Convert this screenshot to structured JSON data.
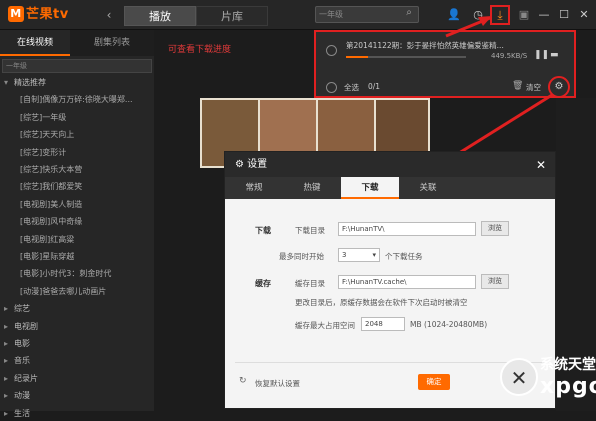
{
  "app": {
    "logo_text": "芒果tv",
    "logo_mark": "M"
  },
  "topbar": {
    "back_icon": "back-arrow-icon",
    "tabs": [
      "播放",
      "片库"
    ],
    "search_placeholder": "一年级",
    "search_icon": "search-icon",
    "icons": [
      "user-icon",
      "history-icon",
      "download-icon",
      "skin-icon",
      "minimize-icon",
      "maximize-icon",
      "close-icon"
    ],
    "download_tooltip": "下载"
  },
  "sidebar": {
    "tabs": [
      "在线视频",
      "剧集列表"
    ],
    "search_value": "一年级",
    "items": [
      {
        "label": "精选推荐",
        "sub": false,
        "arrow": "▾"
      },
      {
        "label": "[自制]偶像万万碎:徐晓大曝郑...",
        "sub": true
      },
      {
        "label": "[综艺]一年级",
        "sub": true
      },
      {
        "label": "[综艺]天天向上",
        "sub": true
      },
      {
        "label": "[综艺]变形计",
        "sub": true
      },
      {
        "label": "[综艺]快乐大本营",
        "sub": true
      },
      {
        "label": "[综艺]我们都爱笑",
        "sub": true
      },
      {
        "label": "[电视剧]美人制造",
        "sub": true
      },
      {
        "label": "[电视剧]风中奇缘",
        "sub": true
      },
      {
        "label": "[电视剧]红高粱",
        "sub": true
      },
      {
        "label": "[电影]星际穿越",
        "sub": true
      },
      {
        "label": "[电影]小时代3：刺金时代",
        "sub": true
      },
      {
        "label": "[动漫]爸爸去哪儿动画片",
        "sub": true
      },
      {
        "label": "综艺",
        "sub": false,
        "arrow": "▸"
      },
      {
        "label": "电视剧",
        "sub": false,
        "arrow": "▸"
      },
      {
        "label": "电影",
        "sub": false,
        "arrow": "▸"
      },
      {
        "label": "音乐",
        "sub": false,
        "arrow": "▸"
      },
      {
        "label": "纪录片",
        "sub": false,
        "arrow": "▸"
      },
      {
        "label": "动漫",
        "sub": false,
        "arrow": "▸"
      },
      {
        "label": "生活",
        "sub": false,
        "arrow": "▸"
      }
    ]
  },
  "annotation": "可查看下载进度",
  "download_panel": {
    "item_title": "第20141122期：彭于晏拌怕然英雄偏爱鉴精...",
    "progress": 0.18,
    "speed": "449.5KB/S",
    "select_all": "全选",
    "count": "0/1",
    "clear": "清空"
  },
  "settings": {
    "title": "设置",
    "title_icon": "gear-icon",
    "tabs": [
      "常规",
      "热键",
      "下载",
      "关联"
    ],
    "active_tab": "下载",
    "download_section": "下载",
    "dir_label": "下载目录",
    "dir_value": "F:\\HunanTV\\",
    "browse": "浏览",
    "max_label": "最多同时开始",
    "max_value": "3",
    "max_suffix": "个下载任务",
    "cache_section": "缓存",
    "cache_dir_label": "缓存目录",
    "cache_dir_value": "F:\\HunanTV.cache\\",
    "cache_note": "更改目录后，原缓存数据会在软件下次启动时被清空",
    "cache_max_label": "缓存最大占用空间",
    "cache_max_value": "2048",
    "cache_max_suffix": "MB (1024-20480MB)",
    "restore": "恢复默认设置",
    "ok": "确定"
  },
  "watermark": {
    "top": "系统天堂",
    "bottom": "xpgod",
    "mark": "✕"
  }
}
